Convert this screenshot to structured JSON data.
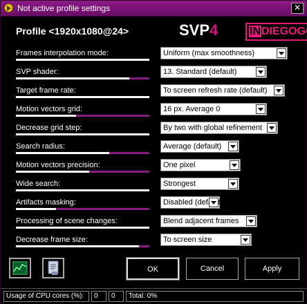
{
  "window": {
    "title": "Not active profile settings",
    "close_glyph": "✕"
  },
  "profile": {
    "title": "Profile <1920x1080@24>"
  },
  "logo": {
    "svp": "SVP",
    "four": "4",
    "in": "IN",
    "rest": "DIEGOGO"
  },
  "settings": [
    {
      "label": "Frames interpolation mode:",
      "value": "Uniform (max smoothness)",
      "level": 1.0
    },
    {
      "label": "SVP shader:",
      "value": "13. Standard (default)",
      "level": 0.85
    },
    {
      "label": "Target frame rate:",
      "value": "To screen refresh rate (default)",
      "level": 1.0
    },
    {
      "label": "Motion vectors grid:",
      "value": "16 px. Average 0",
      "level": 0.45
    },
    {
      "label": "Decrease grid step:",
      "value": "By two with global refinement",
      "level": 1.0
    },
    {
      "label": "Search radius:",
      "value": "Average (default)",
      "level": 0.7
    },
    {
      "label": "Motion vectors precision:",
      "value": "One pixel",
      "level": 0.55
    },
    {
      "label": "Wide search:",
      "value": "Strongest",
      "level": 1.0
    },
    {
      "label": "Artifacts masking:",
      "value": "Disabled (default)",
      "level": 0.3
    },
    {
      "label": "Processing of scene changes:",
      "value": "Blend adjacent frames",
      "level": 1.0
    },
    {
      "label": "Decrease frame size:",
      "value": "To screen size",
      "level": 0.92
    }
  ],
  "buttons": {
    "ok": "OK",
    "cancel": "Cancel",
    "apply": "Apply"
  },
  "icons": {
    "graph": "graph-icon",
    "info": "info-icon"
  },
  "status": {
    "cpu_label": "Usage of CPU cores (%):",
    "core1": "0",
    "core2": "0",
    "total": "Total: 0%"
  },
  "colors": {
    "accent": "#8c1a86",
    "logo_pink": "#e8197a"
  }
}
